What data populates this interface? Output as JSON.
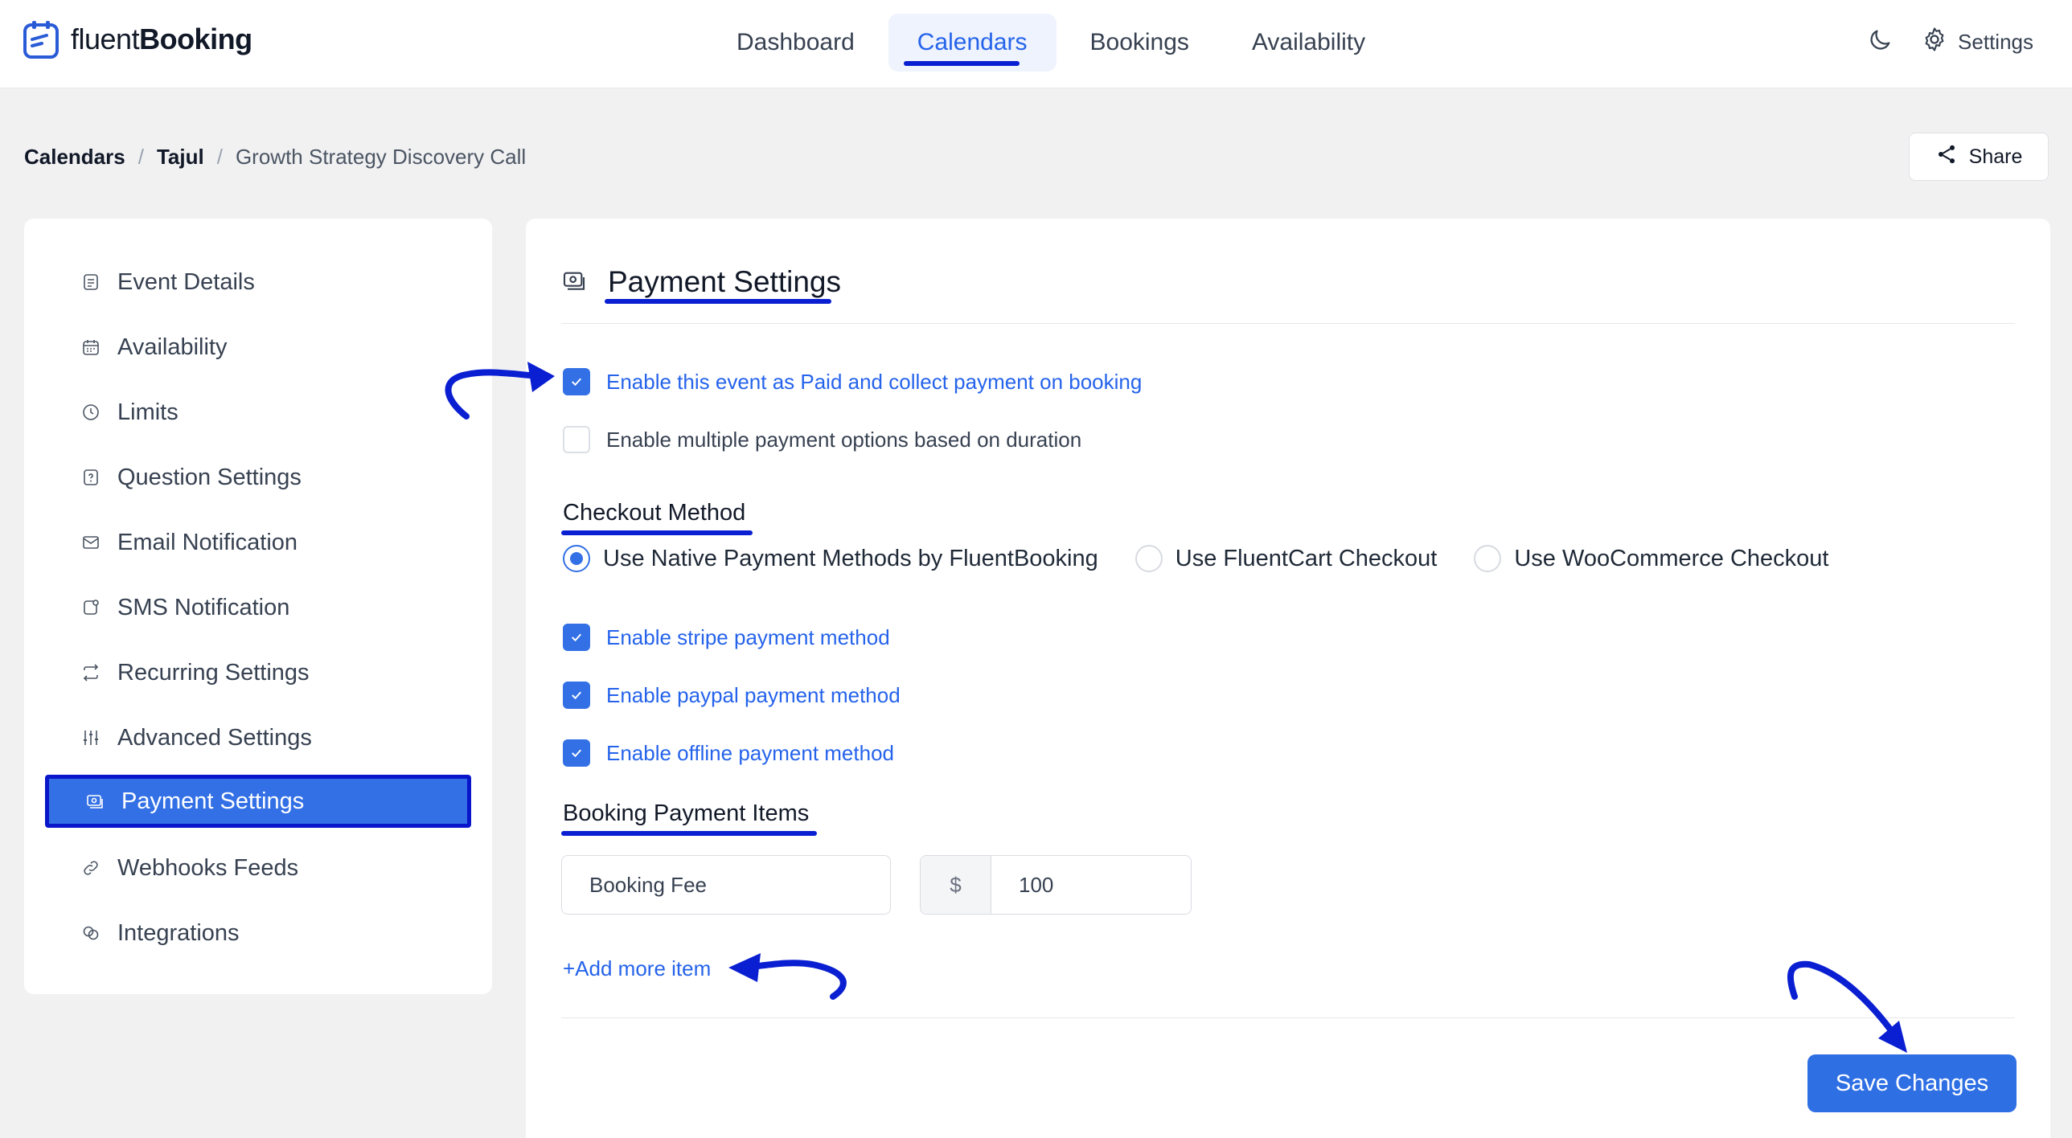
{
  "app": {
    "logo_light": "fluent",
    "logo_bold": "Booking"
  },
  "nav": {
    "items": [
      {
        "label": "Dashboard",
        "active": false
      },
      {
        "label": "Calendars",
        "active": true
      },
      {
        "label": "Bookings",
        "active": false
      },
      {
        "label": "Availability",
        "active": false
      }
    ],
    "settings_label": "Settings"
  },
  "breadcrumb": {
    "root": "Calendars",
    "parent": "Tajul",
    "current": "Growth Strategy Discovery Call",
    "separator": "/"
  },
  "share_label": "Share",
  "sidebar": {
    "items": [
      {
        "label": "Event Details",
        "icon": "document-icon"
      },
      {
        "label": "Availability",
        "icon": "calendar-icon"
      },
      {
        "label": "Limits",
        "icon": "clock-icon"
      },
      {
        "label": "Question Settings",
        "icon": "question-icon"
      },
      {
        "label": "Email Notification",
        "icon": "mail-icon"
      },
      {
        "label": "SMS Notification",
        "icon": "sms-icon"
      },
      {
        "label": "Recurring Settings",
        "icon": "repeat-icon"
      },
      {
        "label": "Advanced Settings",
        "icon": "sliders-icon"
      },
      {
        "label": "Payment Settings",
        "icon": "payment-icon",
        "active": true
      },
      {
        "label": "Webhooks Feeds",
        "icon": "link-icon"
      },
      {
        "label": "Integrations",
        "icon": "integrations-icon"
      }
    ]
  },
  "payment": {
    "title": "Payment Settings",
    "enable_paid": {
      "label": "Enable this event as Paid and collect payment on booking",
      "checked": true
    },
    "enable_multiple": {
      "label": "Enable multiple payment options based on duration",
      "checked": false
    },
    "checkout_title": "Checkout Method",
    "checkout_options": [
      {
        "label": "Use Native Payment Methods by FluentBooking",
        "selected": true
      },
      {
        "label": "Use FluentCart Checkout",
        "selected": false
      },
      {
        "label": "Use WooCommerce Checkout",
        "selected": false
      }
    ],
    "methods": [
      {
        "label": "Enable stripe payment method",
        "checked": true
      },
      {
        "label": "Enable paypal payment method",
        "checked": true
      },
      {
        "label": "Enable offline payment method",
        "checked": true
      }
    ],
    "items_title": "Booking Payment Items",
    "item_name": "Booking Fee",
    "currency_symbol": "$",
    "item_amount": "100",
    "add_more_label": "+Add more item",
    "save_label": "Save Changes"
  },
  "colors": {
    "accent": "#3370e5",
    "annotation": "#0a1fd1"
  }
}
